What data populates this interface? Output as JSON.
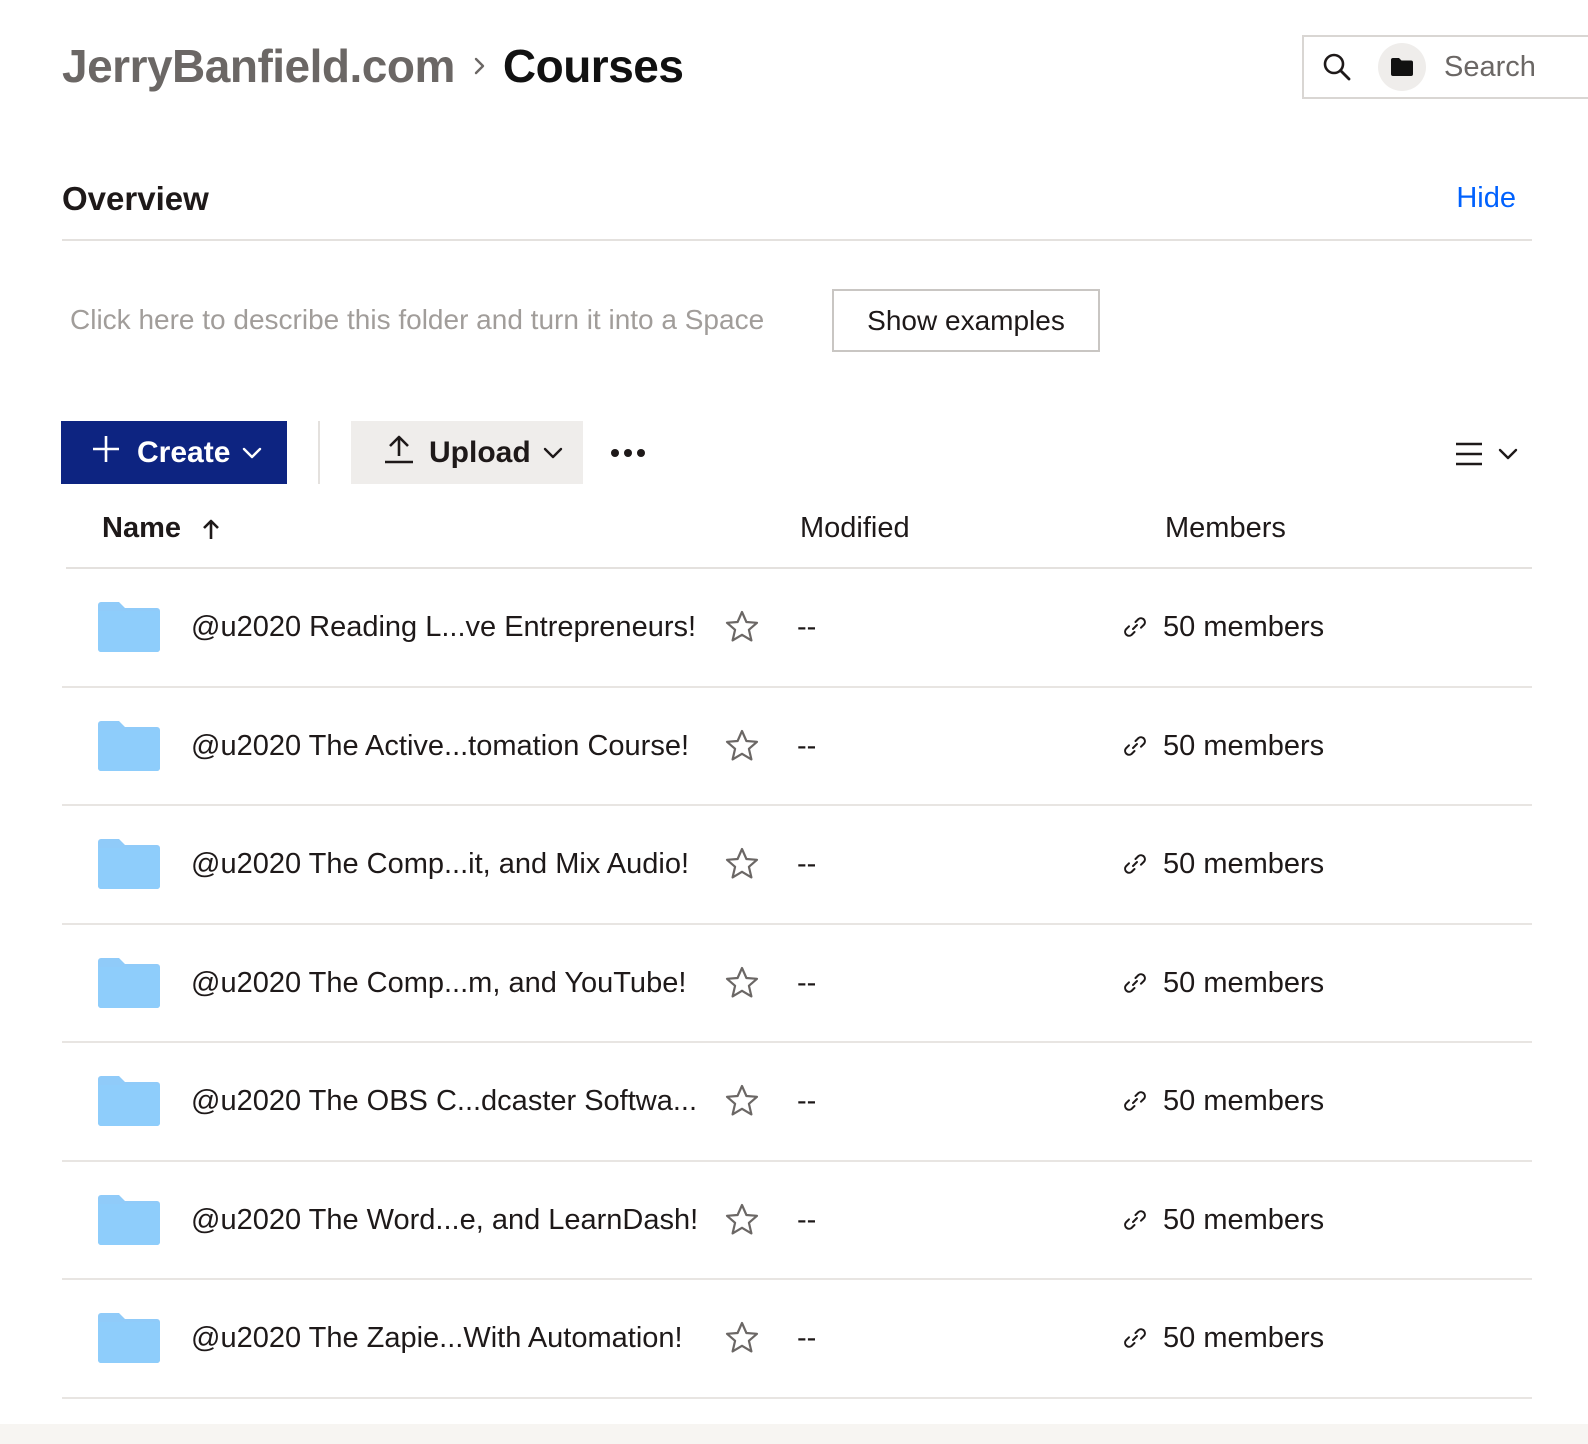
{
  "breadcrumb": {
    "parent": "JerryBanfield.com",
    "current": "Courses"
  },
  "search": {
    "placeholder": "Search",
    "icon": "search-icon",
    "scope_icon": "folder-icon"
  },
  "overview": {
    "title": "Overview",
    "hide_label": "Hide",
    "description_prompt": "Click here to describe this folder and turn it into a Space",
    "examples_label": "Show examples"
  },
  "toolbar": {
    "create_label": "Create",
    "upload_label": "Upload",
    "more_icon": "more-horizontal-icon",
    "view_icon": "list-view-icon"
  },
  "table": {
    "columns": {
      "name": "Name",
      "modified": "Modified",
      "members": "Members"
    },
    "sort_icon": "arrow-up-icon",
    "rows": [
      {
        "name": "@u2020 Reading L...ve Entrepreneurs!",
        "modified": "--",
        "members": "50 members"
      },
      {
        "name": "@u2020 The Active...tomation Course!",
        "modified": "--",
        "members": "50 members"
      },
      {
        "name": "@u2020 The Comp...it, and Mix Audio!",
        "modified": "--",
        "members": "50 members"
      },
      {
        "name": "@u2020 The Comp...m, and YouTube!",
        "modified": "--",
        "members": "50 members"
      },
      {
        "name": "@u2020 The OBS C...dcaster Softwa...",
        "modified": "--",
        "members": "50 members"
      },
      {
        "name": "@u2020 The Word...e, and LearnDash!",
        "modified": "--",
        "members": "50 members"
      },
      {
        "name": "@u2020 The Zapie...With Automation!",
        "modified": "--",
        "members": "50 members"
      }
    ]
  },
  "colors": {
    "create_button": "#0d2481",
    "link": "#0061fe",
    "folder": "#90cbf9"
  }
}
